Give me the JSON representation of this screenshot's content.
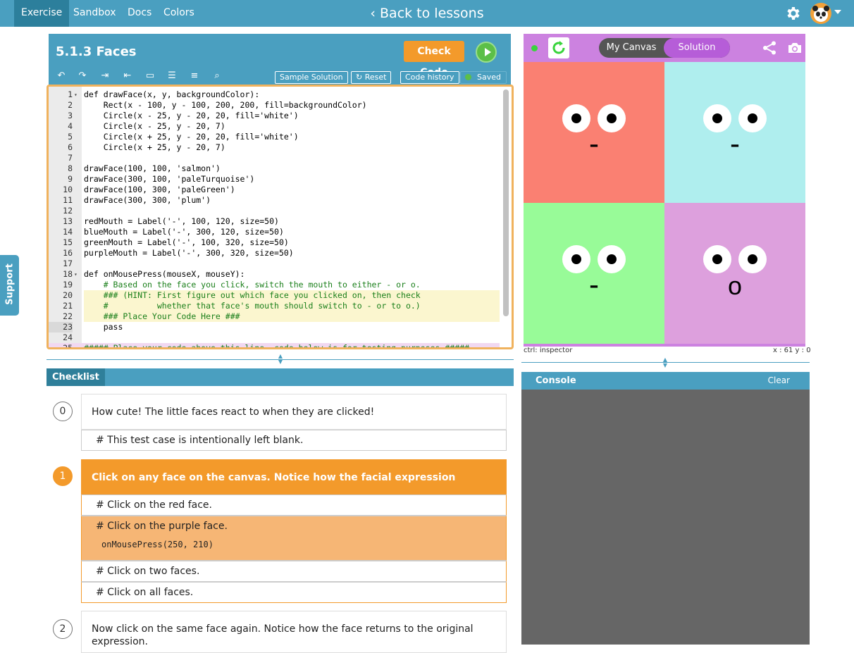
{
  "nav": {
    "tabs": [
      {
        "label": "Exercise",
        "active": true
      },
      {
        "label": "Sandbox"
      },
      {
        "label": "Docs"
      },
      {
        "label": "Colors"
      }
    ],
    "back_link": "‹ Back to lessons"
  },
  "editor": {
    "title": "5.1.3 Faces",
    "check_code": "Check Code",
    "sample_solution": "Sample Solution",
    "reset": "Reset",
    "code_history": "Code history",
    "saved": "Saved",
    "lines": [
      "def drawFace(x, y, backgroundColor):",
      "    Rect(x - 100, y - 100, 200, 200, fill=backgroundColor)",
      "    Circle(x - 25, y - 20, 20, fill='white')",
      "    Circle(x - 25, y - 20, 7)",
      "    Circle(x + 25, y - 20, 20, fill='white')",
      "    Circle(x + 25, y - 20, 7)",
      "",
      "drawFace(100, 100, 'salmon')",
      "drawFace(300, 100, 'paleTurquoise')",
      "drawFace(100, 300, 'paleGreen')",
      "drawFace(300, 300, 'plum')",
      "",
      "redMouth = Label('-', 100, 120, size=50)",
      "blueMouth = Label('-', 300, 120, size=50)",
      "greenMouth = Label('-', 100, 320, size=50)",
      "purpleMouth = Label('-', 300, 320, size=50)",
      "",
      "def onMousePress(mouseX, mouseY):",
      "    # Based on the face you click, switch the mouth to either - or o.",
      "    ### (HINT: First figure out which face you clicked on, then check",
      "    #          whether that face's mouth should switch to - or to o.)",
      "    ### Place Your Code Here ###",
      "    pass",
      "",
      "##### Place your code above this line, code below is for testing purposes #####"
    ]
  },
  "canvas": {
    "my_canvas": "My Canvas",
    "solution": "Solution",
    "inspector": "ctrl: inspector",
    "coords": "x : 61  y : 0",
    "faces": [
      {
        "color": "#fa8072",
        "mouth": "-"
      },
      {
        "color": "#afeeee",
        "mouth": "-"
      },
      {
        "color": "#98fb98",
        "mouth": "-"
      },
      {
        "color": "#dda0dd",
        "mouth": "o"
      }
    ]
  },
  "checklist": {
    "tab": "Checklist",
    "steps": [
      {
        "num": "0",
        "title": "How cute! The little faces react to when they are clicked!",
        "rows": [
          "# This test case is intentionally left blank."
        ]
      },
      {
        "num": "1",
        "title": "Click on any face on the canvas. Notice how the facial expression changes.",
        "rows": [
          "# Click on the red face.",
          "# Click on the purple face.",
          "# Click on two faces.",
          "# Click on all faces."
        ],
        "selected_code": "onMousePress(250, 210)"
      },
      {
        "num": "2",
        "title": "Now click on the same face again. Notice how the face returns to the original expression."
      }
    ]
  },
  "console": {
    "title": "Console",
    "clear": "Clear"
  },
  "support": "Support",
  "colors": {
    "primary": "#4a9fc0",
    "accent": "#f39a2b",
    "canvas_header": "#cc82e0"
  }
}
